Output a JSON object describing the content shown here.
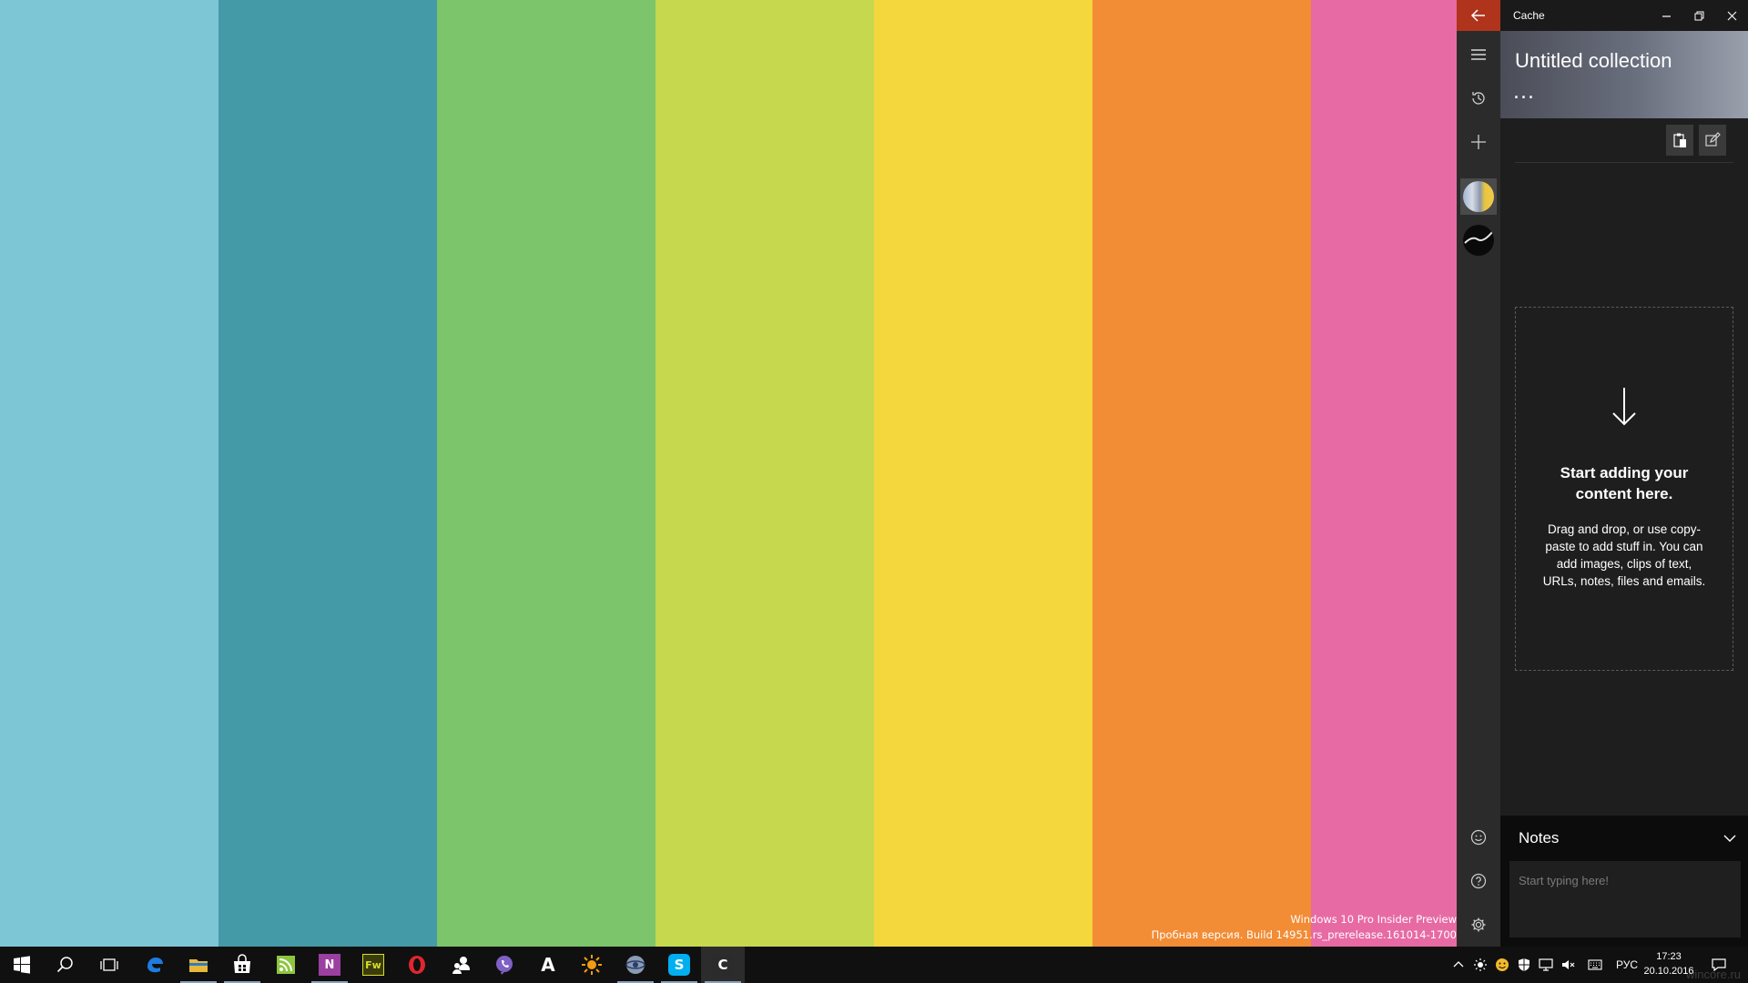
{
  "wallpaper": {
    "stripes": [
      "#7cc6d6",
      "#449aa6",
      "#7dc56b",
      "#c6d84d",
      "#f4d63d",
      "#f28c35",
      "#e76aa4"
    ]
  },
  "watermark": {
    "line1": "Windows 10 Pro Insider Preview",
    "line2": "Пробная версия. Build 14951.rs_prerelease.161014-1700"
  },
  "app": {
    "title": "Cache",
    "accent": "#b0331c",
    "collection_title": "Untitled collection",
    "more_label": "...",
    "nav": {
      "back_icon": "arrow-left-icon",
      "menu_icon": "hamburger-icon",
      "history_icon": "history-icon",
      "add_icon": "plus-icon",
      "feedback_icon": "smiley-icon",
      "help_icon": "question-icon",
      "settings_icon": "gear-icon"
    },
    "toolbar": {
      "paste_icon": "clipboard-icon",
      "edit_icon": "edit-icon"
    },
    "drop_zone": {
      "title": "Start adding your content here.",
      "description": "Drag and drop, or use copy-paste to add stuff in. You can add images, clips of text, URLs, notes, files and emails."
    },
    "notes": {
      "title": "Notes",
      "placeholder": "Start typing here!"
    }
  },
  "taskbar": {
    "apps": [
      {
        "name": "edge",
        "label": "e",
        "color": "#1f7ce0",
        "running": false
      },
      {
        "name": "file-explorer",
        "label": "",
        "color": "#e8b73b",
        "running": true
      },
      {
        "name": "store",
        "label": "",
        "color": "#ffffff",
        "running": true
      },
      {
        "name": "feed-reader",
        "label": "",
        "color": "#8cc63f",
        "running": false
      },
      {
        "name": "onenote",
        "label": "N",
        "color": "#9b3fa0",
        "running": true
      },
      {
        "name": "fireworks",
        "label": "Fw",
        "color": "#d7df23",
        "running": false
      },
      {
        "name": "opera",
        "label": "O",
        "color": "#e0262e",
        "running": false
      },
      {
        "name": "connections",
        "label": "",
        "color": "#ffffff",
        "running": false
      },
      {
        "name": "viber",
        "label": "",
        "color": "#7f61c5",
        "running": false
      },
      {
        "name": "fonts",
        "label": "A",
        "color": "#ffffff",
        "running": false
      },
      {
        "name": "weather",
        "label": "",
        "color": "#f39c12",
        "running": false
      },
      {
        "name": "360",
        "label": "",
        "color": "#8a9bb5",
        "running": true
      },
      {
        "name": "skype",
        "label": "S",
        "color": "#00aff0",
        "running": true
      },
      {
        "name": "cache",
        "label": "C",
        "color": "#ffffff",
        "running": true,
        "active": true
      }
    ],
    "language": "РУС",
    "time": "17:23",
    "date": "20.10.2016",
    "corner_text": "wincore.ru"
  }
}
